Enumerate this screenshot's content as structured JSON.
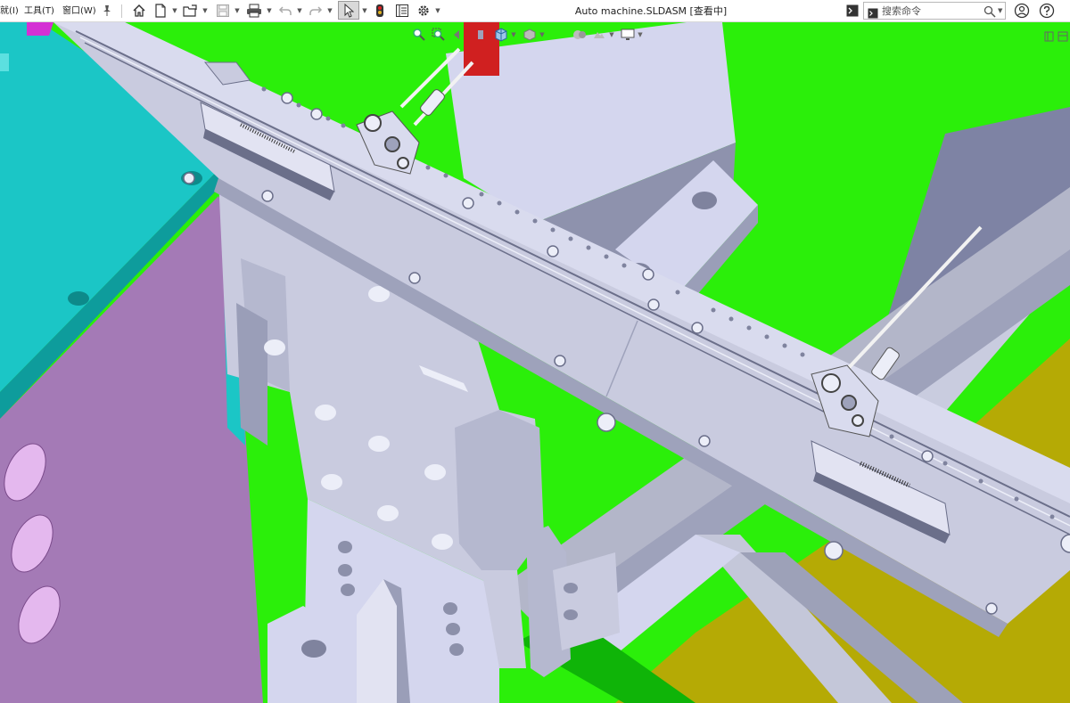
{
  "app": {
    "window_title": "Auto machine.SLDASM [查看中]"
  },
  "menu": {
    "items": [
      {
        "label": "就(I)"
      },
      {
        "label": "工具(T)"
      },
      {
        "label": "窗口(W)"
      }
    ],
    "pin_icon": "pin-icon"
  },
  "toolbar": {
    "icons": [
      "home-icon",
      "new-document-icon",
      "open-folder-icon",
      "save-icon",
      "print-icon",
      "undo-icon",
      "redo-icon",
      "select-arrow-icon",
      "traffic-light-icon",
      "file-properties-icon",
      "options-gear-icon"
    ]
  },
  "search": {
    "placeholder": "搜索命令"
  },
  "view": {
    "heads_up_icons": [
      "zoom-to-fit-icon",
      "zoom-to-area-icon",
      "previous-view-icon",
      "section-view-icon",
      "view-orientation-icon",
      "display-style-icon",
      "hide-show-icon",
      "edit-appearance-icon",
      "apply-scene-icon",
      "view-settings-icon"
    ]
  },
  "colors": {
    "background_green": "#2bef0a",
    "part_lavender": "#d4d6ee",
    "part_teal": "#1bc6c6",
    "part_purple": "#a47ab6",
    "part_olive": "#b5aa05",
    "part_red": "#d02020"
  }
}
